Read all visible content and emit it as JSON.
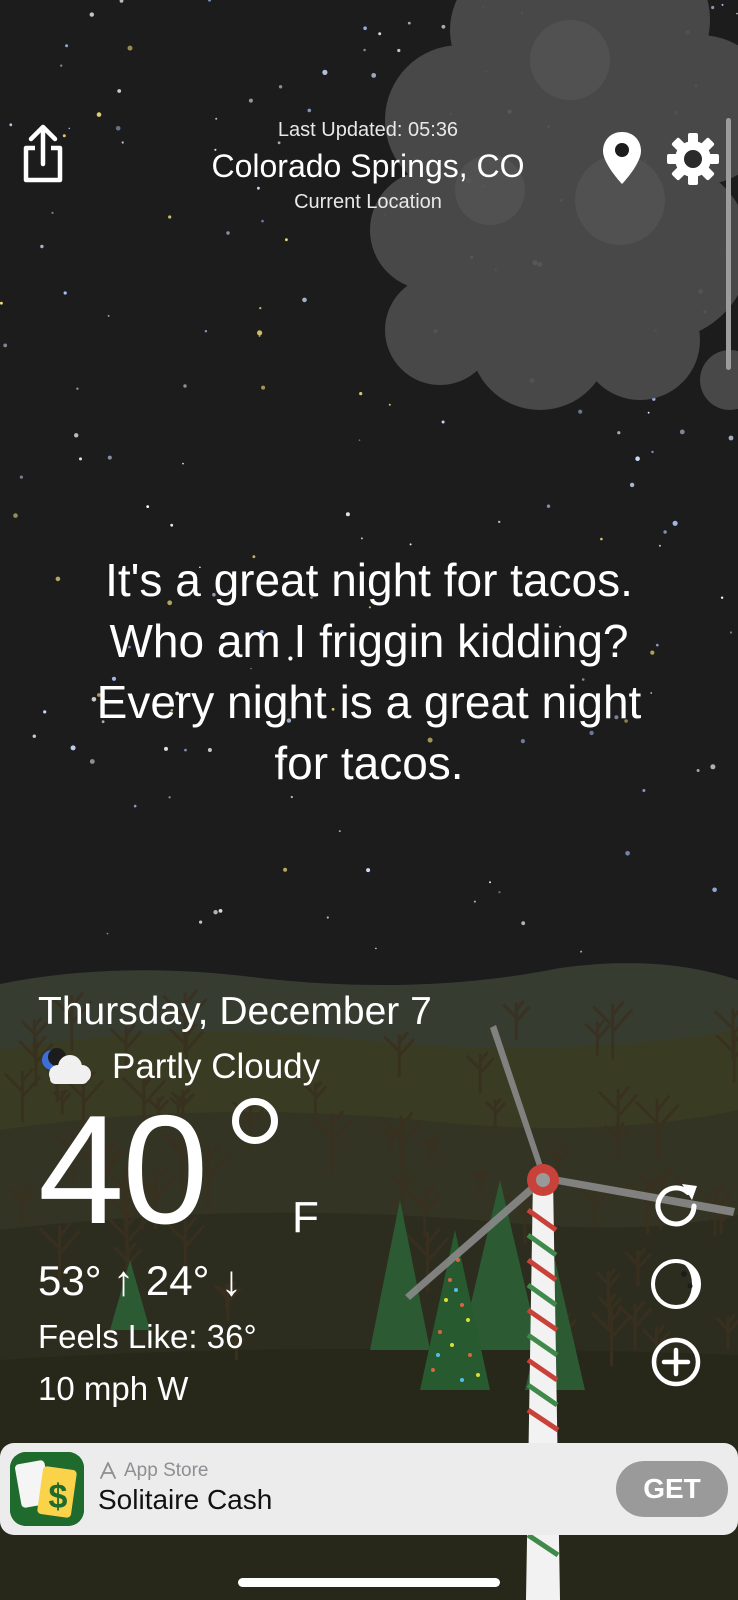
{
  "header": {
    "last_updated": "Last Updated: 05:36",
    "city": "Colorado Springs, CO",
    "location_label": "Current Location"
  },
  "quote": {
    "line1": "It's a great night for tacos.",
    "line2": "Who am I friggin kidding?",
    "line3": "Every night is a great night",
    "line4": "for tacos."
  },
  "weather": {
    "date": "Thursday, December 7",
    "condition": "Partly Cloudy",
    "condition_icon": "partly-cloudy-night-icon",
    "temperature": "40",
    "unit": "F",
    "high_low": "53° ↑  24° ↓",
    "feels_like": "Feels Like: 36°",
    "wind": "10 mph W"
  },
  "ad": {
    "store_label": "App Store",
    "app_name": "Solitaire Cash",
    "cta": "GET"
  },
  "colors": {
    "sky": "#1c1c1d",
    "hills": "#2f3424",
    "ad_background": "#ececec",
    "get_button": "#9a9a9a"
  }
}
